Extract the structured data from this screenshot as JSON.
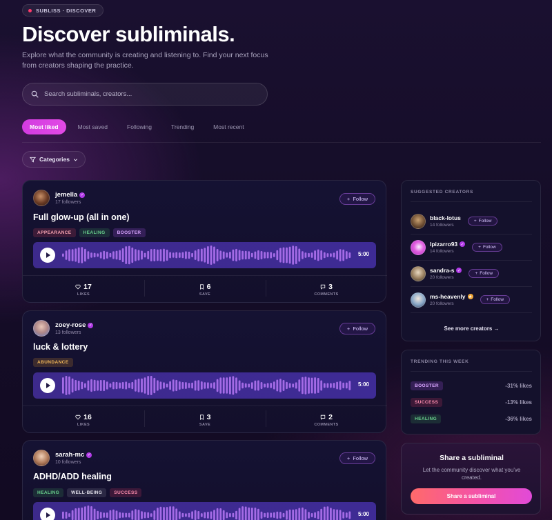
{
  "badge": "SUBLISS · DISCOVER",
  "heading": "Discover subliminals.",
  "subtitle": "Explore what the community is creating and listening to. Find your next focus from creators shaping the practice.",
  "search": {
    "placeholder": "Search subliminals, creators..."
  },
  "tabs": [
    "Most liked",
    "Most saved",
    "Following",
    "Trending",
    "Most recent"
  ],
  "active_tab": "Most liked",
  "categories_label": "Categories",
  "feed": [
    {
      "user": "jemella",
      "followers": "17 followers",
      "verified": true,
      "follow_label": "Follow",
      "title": "Full glow-up (all in one)",
      "tags": [
        "APPEARANCE",
        "HEALING",
        "BOOSTER"
      ],
      "duration": "5:00",
      "likes": "17",
      "saves": "6",
      "comments": "3",
      "likes_label": "LIKES",
      "save_label": "SAVE",
      "comments_label": "COMMENTS"
    },
    {
      "user": "zoey-rose",
      "followers": "13 followers",
      "verified": true,
      "follow_label": "Follow",
      "title": "luck & lottery",
      "tags": [
        "ABUNDANCE"
      ],
      "duration": "5:00",
      "likes": "16",
      "saves": "3",
      "comments": "2",
      "likes_label": "LIKES",
      "save_label": "SAVE",
      "comments_label": "COMMENTS"
    },
    {
      "user": "sarah-mc",
      "followers": "10 followers",
      "verified": true,
      "follow_label": "Follow",
      "title": "ADHD/ADD healing",
      "tags": [
        "HEALING",
        "WELL-BEING",
        "SUCCESS"
      ],
      "duration": "5:00"
    }
  ],
  "suggested": {
    "title": "SUGGESTED CREATORS",
    "creators": [
      {
        "name": "black-lotus",
        "followers": "14 followers",
        "badge": "",
        "follow": "Follow"
      },
      {
        "name": "lpizarro93",
        "followers": "14 followers",
        "badge": "verified",
        "follow": "Follow"
      },
      {
        "name": "sandra-s",
        "followers": "20 followers",
        "badge": "verified",
        "follow": "Follow"
      },
      {
        "name": "ms-heavenly",
        "followers": "20 followers",
        "badge": "gold",
        "follow": "Follow"
      }
    ],
    "see_more": "See more creators →"
  },
  "trending": {
    "title": "TRENDING THIS WEEK",
    "items": [
      {
        "tag": "BOOSTER",
        "value": "-31% likes"
      },
      {
        "tag": "SUCCESS",
        "value": "-13% likes"
      },
      {
        "tag": "HEALING",
        "value": "-36% likes"
      }
    ]
  },
  "share": {
    "title": "Share a subliminal",
    "text": "Let the community discover what you've created.",
    "button": "Share a subliminal"
  },
  "colors": {
    "accent": "#d23be0",
    "player": "#3d2a8c",
    "wave": "#a46be6"
  }
}
